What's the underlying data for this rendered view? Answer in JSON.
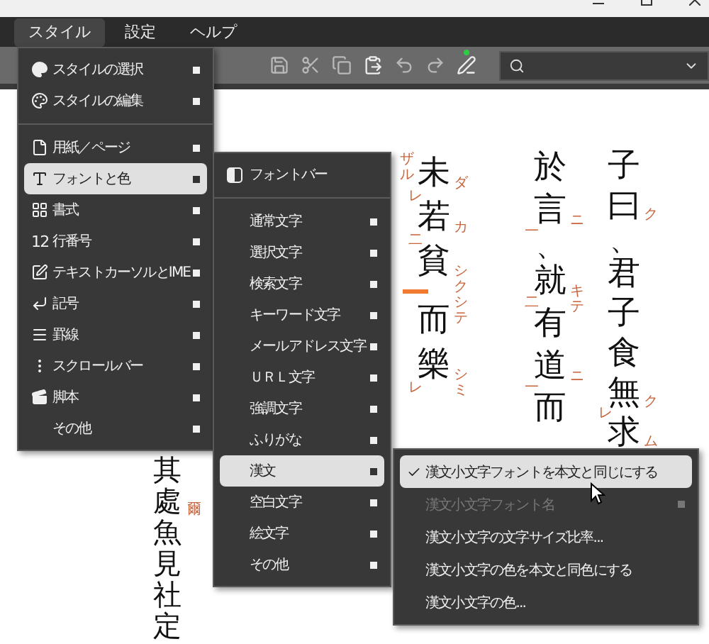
{
  "menubar": [
    {
      "label": "スタイル",
      "selected": true
    },
    {
      "label": "設定",
      "selected": false
    },
    {
      "label": "ヘルプ",
      "selected": false
    }
  ],
  "document": {
    "columns": [
      {
        "cells": [
          {
            "kind": "char",
            "text": "其"
          },
          {
            "kind": "char",
            "text": "處",
            "ruby": "爾"
          },
          {
            "kind": "char",
            "text": "魚"
          },
          {
            "kind": "char",
            "text": "見"
          },
          {
            "kind": "char",
            "text": "社"
          },
          {
            "kind": "char",
            "text": "定"
          }
        ]
      },
      {
        "cells": [
          {
            "kind": "char",
            "text": "未",
            "ruby": "ダ",
            "mark": "レ",
            "left_ruby": "ザル"
          },
          {
            "kind": "char",
            "text": "若",
            "ruby": "カ",
            "mark": "二"
          },
          {
            "kind": "char",
            "text": "貧",
            "ruby": "シクシテ"
          },
          {
            "kind": "cursor"
          },
          {
            "kind": "char",
            "text": "而"
          },
          {
            "kind": "char",
            "text": "樂",
            "ruby": "シミ",
            "mark": "レ"
          }
        ]
      },
      {
        "cells": [
          {
            "kind": "char",
            "text": "於"
          },
          {
            "kind": "char",
            "text": "言",
            "ruby": "ニ",
            "mark": "一"
          },
          {
            "kind": "char",
            "text": "、"
          },
          {
            "kind": "char",
            "text": "就",
            "ruby": "キテ",
            "mark": "二"
          },
          {
            "kind": "char",
            "text": "有"
          },
          {
            "kind": "char",
            "text": "道",
            "ruby": "ニ",
            "mark": "一"
          },
          {
            "kind": "char",
            "text": "而"
          }
        ]
      },
      {
        "cells": [
          {
            "kind": "char",
            "text": "子"
          },
          {
            "kind": "char",
            "text": "曰",
            "ruby": "ク"
          },
          {
            "kind": "char",
            "text": "、"
          },
          {
            "kind": "char",
            "text": "君"
          },
          {
            "kind": "char",
            "text": "子"
          },
          {
            "kind": "char",
            "text": "食"
          },
          {
            "kind": "char",
            "text": "無",
            "ruby": "ク",
            "mark": "レ"
          },
          {
            "kind": "char",
            "text": "求",
            "ruby": "ム"
          }
        ]
      }
    ]
  },
  "style_menu": {
    "items": [
      {
        "kind": "item",
        "label": "スタイルの選択",
        "selected": false
      },
      {
        "kind": "item",
        "label": "スタイルの編集",
        "selected": false
      },
      {
        "kind": "separator"
      },
      {
        "kind": "item",
        "label": "用紙／ページ",
        "selected": false
      },
      {
        "kind": "item",
        "label": "フォントと色",
        "selected": true
      },
      {
        "kind": "item",
        "label": "書式",
        "selected": false
      },
      {
        "kind": "item",
        "label": "行番号",
        "icon_text": "12",
        "selected": false
      },
      {
        "kind": "item",
        "label": "テキストカーソルとIME",
        "selected": false
      },
      {
        "kind": "item",
        "label": "記号",
        "selected": false
      },
      {
        "kind": "item",
        "label": "罫線",
        "selected": false
      },
      {
        "kind": "item",
        "label": "スクロールバー",
        "selected": false
      },
      {
        "kind": "item",
        "label": "脚本",
        "selected": false
      },
      {
        "kind": "item",
        "label": "その他",
        "selected": false
      }
    ]
  },
  "font_menu": {
    "items": [
      {
        "kind": "header",
        "label": "フォントバー"
      },
      {
        "kind": "separator"
      },
      {
        "kind": "item",
        "label": "通常文字",
        "selected": false
      },
      {
        "kind": "item",
        "label": "選択文字",
        "selected": false
      },
      {
        "kind": "item",
        "label": "検索文字",
        "selected": false
      },
      {
        "kind": "item",
        "label": "キーワード文字",
        "selected": false
      },
      {
        "kind": "item",
        "label": "メールアドレス文字",
        "selected": false
      },
      {
        "kind": "item",
        "label": "ＵＲＬ文字",
        "selected": false
      },
      {
        "kind": "item",
        "label": "強調文字",
        "selected": false
      },
      {
        "kind": "item",
        "label": "ふりがな",
        "selected": false
      },
      {
        "kind": "item",
        "label": "漢文",
        "selected": true
      },
      {
        "kind": "item",
        "label": "空白文字",
        "selected": false
      },
      {
        "kind": "item",
        "label": "絵文字",
        "selected": false
      },
      {
        "kind": "item",
        "label": "その他",
        "selected": false
      }
    ]
  },
  "kanbun_menu": {
    "items": [
      {
        "label": "漢文小文字フォントを本文と同じにする",
        "checked": true,
        "selected": true,
        "disabled": false,
        "submenu": false
      },
      {
        "label": "漢文小文字フォント名",
        "checked": false,
        "selected": false,
        "disabled": true,
        "submenu": true
      },
      {
        "label": "漢文小文字の文字サイズ比率...",
        "checked": false,
        "selected": false,
        "disabled": false,
        "submenu": false
      },
      {
        "label": "漢文小文字の色を本文と同色にする",
        "checked": false,
        "selected": false,
        "disabled": false,
        "submenu": false
      },
      {
        "label": "漢文小文字の色...",
        "checked": false,
        "selected": false,
        "disabled": false,
        "submenu": false
      }
    ]
  }
}
